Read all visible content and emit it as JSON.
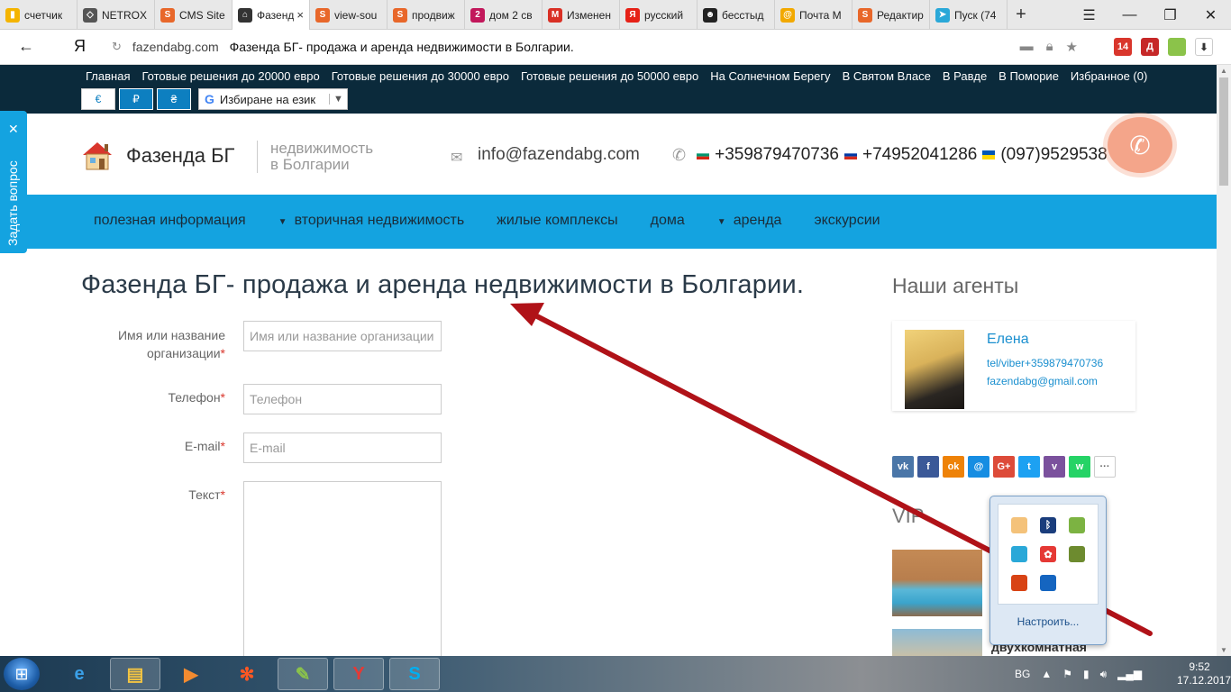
{
  "browser": {
    "tabs": [
      {
        "label": "счетчик",
        "icon": "bar-chart-icon",
        "color": "#f4b400"
      },
      {
        "label": "NETROX",
        "icon": "diamond-icon",
        "color": "#555555"
      },
      {
        "label": "CMS Site",
        "icon": "s-logo-icon",
        "color": "#e8672a"
      },
      {
        "label": "Фазенд",
        "icon": "home-icon",
        "color": "#333333",
        "active": true
      },
      {
        "label": "view-sou",
        "icon": "s-logo-icon",
        "color": "#e8672a"
      },
      {
        "label": "продвиж",
        "icon": "s-logo-icon",
        "color": "#e8672a"
      },
      {
        "label": "дом 2 св",
        "icon": "two-badge-icon",
        "color": "#c2185b"
      },
      {
        "label": "Изменен",
        "icon": "gmail-icon",
        "color": "#d93025"
      },
      {
        "label": "русский",
        "icon": "yandex-icon",
        "color": "#e62117"
      },
      {
        "label": "бесстыд",
        "icon": "face-icon",
        "color": "#222222"
      },
      {
        "label": "Почта М",
        "icon": "mail-at-icon",
        "color": "#f2a900"
      },
      {
        "label": "Редактир",
        "icon": "s-logo-icon",
        "color": "#e8672a"
      },
      {
        "label": "Пуск (74",
        "icon": "paper-plane-icon",
        "color": "#2aa8d8"
      }
    ],
    "active_tab_close": "×",
    "new_tab": "+",
    "window_controls": {
      "menu": "☰",
      "minimize": "—",
      "restore": "❐",
      "close": "✕"
    },
    "back": "←",
    "yandex_button": "Я",
    "reload": "↻",
    "address_domain": "fazendabg.com",
    "address_title": "Фазенда БГ- продажа и аренда недвижимости в Болгарии.",
    "ext_badges": {
      "badge1": "14",
      "badge2": "Д"
    }
  },
  "site": {
    "top_nav": [
      "Главная",
      "Готовые решения до 20000 евро",
      "Готовые решения до 30000 евро",
      "Готовые решения до 50000 евро",
      "На Солнечном Берегу",
      "В Святом Власе",
      "В Равде",
      "В Поморие",
      "Избранное (0)"
    ],
    "currencies": [
      "€",
      "₽",
      "₴"
    ],
    "translate": {
      "g": "G",
      "label": "Избиране на език",
      "arrow": "▼"
    },
    "logo_name": "Фазенда БГ",
    "tagline_line1": "недвижимость",
    "tagline_line2": "в Болгарии",
    "email": "info@fazendabg.com",
    "phone1": "+359879470736",
    "phone2": "+74952041286",
    "phone3": "(097)9529538",
    "main_nav": [
      {
        "label": "полезная информация",
        "dropdown": false
      },
      {
        "label": "вторичная недвижимость",
        "dropdown": true
      },
      {
        "label": "жилые комплексы",
        "dropdown": false
      },
      {
        "label": "дома",
        "dropdown": false
      },
      {
        "label": "аренда",
        "dropdown": true
      },
      {
        "label": "экскурсии",
        "dropdown": false
      }
    ],
    "ask_tab": "Задать вопрос",
    "page_title": "Фазенда БГ- продажа и аренда недвижимости в Болгарии.",
    "form": {
      "name_label": "Имя или название организации",
      "name_placeholder": "Имя или название организации",
      "phone_label": "Телефон",
      "phone_placeholder": "Телефон",
      "email_label": "E-mail",
      "email_placeholder": "E-mail",
      "text_label": "Текст",
      "required_mark": "*"
    },
    "sidebar": {
      "agents_title": "Наши агенты",
      "agent_name": "Елена",
      "agent_tel": "tel/viber+359879470736",
      "agent_email": "fazendabg@gmail.com",
      "share": [
        {
          "name": "vk",
          "glyph": "vk",
          "color": "#4a76a8"
        },
        {
          "name": "facebook",
          "glyph": "f",
          "color": "#3b5998"
        },
        {
          "name": "odnoklassniki",
          "glyph": "ok",
          "color": "#ee8208"
        },
        {
          "name": "moimir",
          "glyph": "@",
          "color": "#168de2"
        },
        {
          "name": "googleplus",
          "glyph": "G+",
          "color": "#dd4b39"
        },
        {
          "name": "twitter",
          "glyph": "t",
          "color": "#1da1f2"
        },
        {
          "name": "viber",
          "glyph": "v",
          "color": "#7b519d"
        },
        {
          "name": "whatsapp",
          "glyph": "w",
          "color": "#25d366"
        },
        {
          "name": "more",
          "glyph": "···",
          "color": "#ffffff"
        }
      ],
      "vip_title": "VIP",
      "vip_item_text": "двухкомнатная"
    }
  },
  "tray_popup": {
    "configure_label": "Настроить..."
  },
  "taskbar": {
    "lang": "BG",
    "time": "9:52",
    "date": "17.12.2017"
  }
}
